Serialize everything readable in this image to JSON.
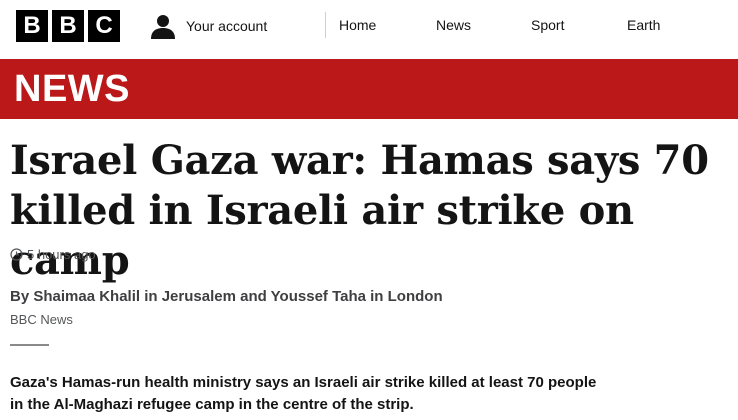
{
  "brand": {
    "letters": [
      "B",
      "B",
      "C"
    ]
  },
  "account": {
    "label": "Your account",
    "icon": "user-icon"
  },
  "nav": {
    "items": [
      "Home",
      "News",
      "Sport",
      "Earth"
    ]
  },
  "banner": {
    "label": "NEWS",
    "color": "#bb1919"
  },
  "article": {
    "headline": "Israel Gaza war: Hamas says 70 killed in Israeli air strike on camp",
    "timestamp": "5 hours ago",
    "byline": "By Shaimaa Khalil in Jerusalem and Youssef Taha in London",
    "organisation": "BBC News",
    "summary": "Gaza's Hamas-run health ministry says an Israeli air strike killed at least 70 people in the Al-Maghazi refugee camp in the centre of the strip."
  }
}
